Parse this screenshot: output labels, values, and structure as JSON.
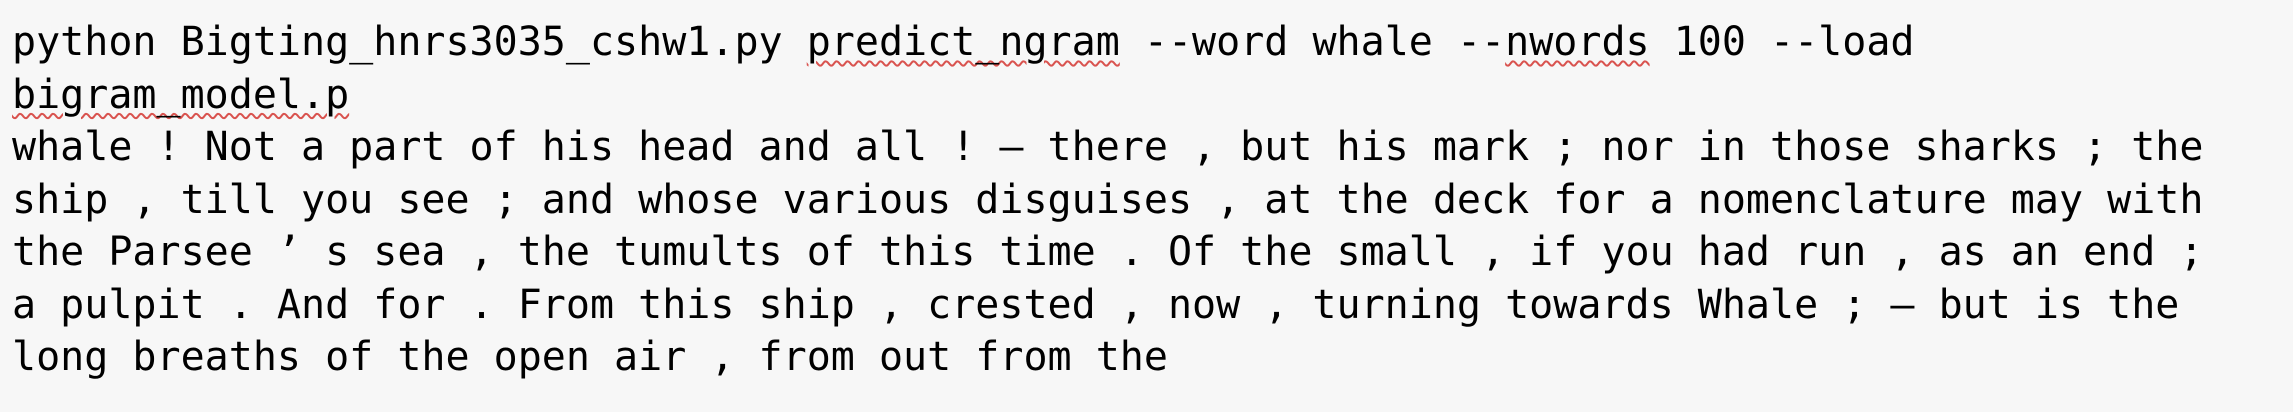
{
  "command": {
    "part1": "python Bigting_hnrs3035_cshw1.py ",
    "mode": "predict_ngram",
    "part2": " --word whale --",
    "flag": "nwords",
    "part3": " 100 --load",
    "model_file": "bigram_model.p"
  },
  "output_lines": [
    "whale ! Not a part of his head and all ! — there , but his mark ; nor in those sharks ; the",
    "ship , till you see ; and whose various disguises , at the deck for a nomenclature may with",
    "the Parsee ’ s sea , the tumults of this time . Of the small , if you had run , as an end ;",
    "a pulpit . And for . From this ship , crested , now , turning towards Whale ; — but is the",
    "long breaths of the open air , from out from the"
  ]
}
